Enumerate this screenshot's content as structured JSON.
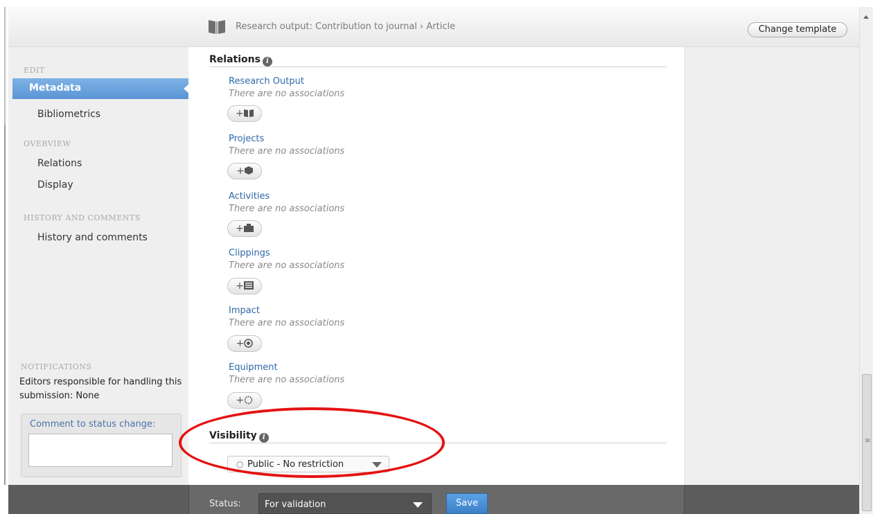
{
  "header": {
    "breadcrumb": "Research output: Contribution to journal › Article",
    "change_template_label": "Change template"
  },
  "sidebar": {
    "edit_title": "EDIT",
    "edit_items": [
      "Metadata",
      "Bibliometrics"
    ],
    "overview_title": "OVERVIEW",
    "overview_items": [
      "Relations",
      "Display"
    ],
    "history_title": "HISTORY AND COMMENTS",
    "history_items": [
      "History and comments"
    ],
    "notifications_title": "NOTIFICATIONS",
    "notifications_text": "Editors responsible for handling this submission: None",
    "comment_label": "Comment to status change:"
  },
  "main": {
    "relations_heading": "Relations",
    "relations": [
      {
        "title": "Research Output",
        "empty": "There are no associations",
        "icon": "book-icon"
      },
      {
        "title": "Projects",
        "empty": "There are no associations",
        "icon": "cube-icon"
      },
      {
        "title": "Activities",
        "empty": "There are no associations",
        "icon": "briefcase-icon"
      },
      {
        "title": "Clippings",
        "empty": "There are no associations",
        "icon": "newspaper-icon"
      },
      {
        "title": "Impact",
        "empty": "There are no associations",
        "icon": "target-icon"
      },
      {
        "title": "Equipment",
        "empty": "There are no associations",
        "icon": "gear-icon"
      }
    ],
    "visibility_heading": "Visibility",
    "visibility_value": "Public - No restriction"
  },
  "footer": {
    "status_label": "Status:",
    "status_value": "For validation",
    "save_label": "Save"
  },
  "colors": {
    "accent": "#5b95d6",
    "link": "#2e68a8",
    "annotation": "#e51212"
  }
}
